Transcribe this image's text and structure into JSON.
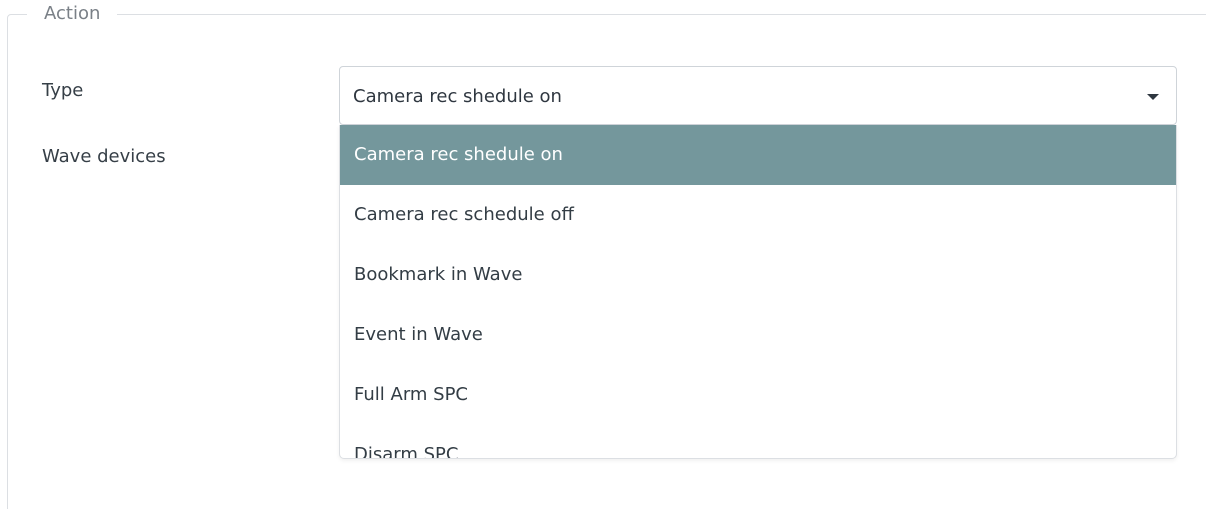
{
  "fieldset": {
    "legend": "Action"
  },
  "form": {
    "type_label": "Type",
    "wave_devices_label": "Wave devices"
  },
  "type_select": {
    "selected_value": "Camera rec shedule on",
    "options": [
      {
        "label": "Camera rec shedule on",
        "selected": true
      },
      {
        "label": "Camera rec schedule off",
        "selected": false
      },
      {
        "label": "Bookmark in Wave",
        "selected": false
      },
      {
        "label": "Event in Wave",
        "selected": false
      },
      {
        "label": "Full Arm SPC",
        "selected": false
      },
      {
        "label": "Disarm SPC",
        "selected": false
      }
    ]
  },
  "colors": {
    "selected_option_bg": "#74979c",
    "text": "#333d45",
    "border": "#dcdfe3"
  }
}
